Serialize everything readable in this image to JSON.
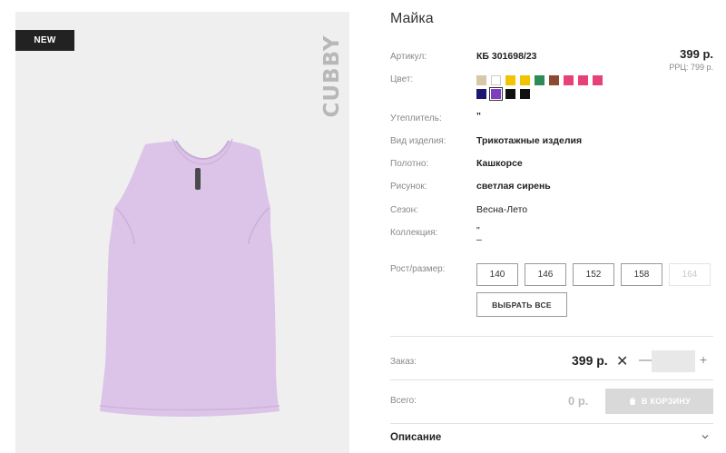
{
  "image": {
    "badge": "NEW",
    "brand": "CUBBY",
    "product_color": "#dcc3e8"
  },
  "product": {
    "title": "Майка",
    "price": "399 р.",
    "rrp": "РРЦ: 799 р."
  },
  "details": {
    "article_label": "Артикул:",
    "article_value": "КБ 301698/23",
    "color_label": "Цвет:",
    "insulation_label": "Утеплитель:",
    "insulation_value": "\"",
    "type_label": "Вид изделия:",
    "type_value": "Трикотажные изделия",
    "fabric_label": "Полотно:",
    "fabric_value": "Кашкорсе",
    "pattern_label": "Рисунок:",
    "pattern_value": "светлая сирень",
    "season_label": "Сезон:",
    "season_value": "Весна-Лето",
    "collection_label": "Коллекция:",
    "collection_value_1": "\"",
    "collection_value_2": "–"
  },
  "swatches": [
    {
      "color": "#d6c8a8"
    },
    {
      "color": "#ffffff"
    },
    {
      "color": "#f2c400"
    },
    {
      "color": "#f2c400"
    },
    {
      "color": "#2e8b57"
    },
    {
      "color": "#8b4a32"
    },
    {
      "color": "#e8407a"
    },
    {
      "color": "#e8407a"
    },
    {
      "color": "#e8407a"
    },
    {
      "color": "#1c1870"
    },
    {
      "color": "#7e3fc0"
    },
    {
      "color": "#111111"
    },
    {
      "color": "#111111"
    }
  ],
  "sizes": {
    "label": "Рост/размер:",
    "options": [
      "140",
      "146",
      "152",
      "158",
      "164"
    ],
    "select_all": "ВЫБРАТЬ ВСЕ"
  },
  "order": {
    "label": "Заказ:",
    "price": "399 р.",
    "times": "✕",
    "minus": "—",
    "plus": "+",
    "quantity": ""
  },
  "total": {
    "label": "Всего:",
    "price": "0 р.",
    "cart_button": "В КОРЗИНУ"
  },
  "description": {
    "label": "Описание"
  }
}
